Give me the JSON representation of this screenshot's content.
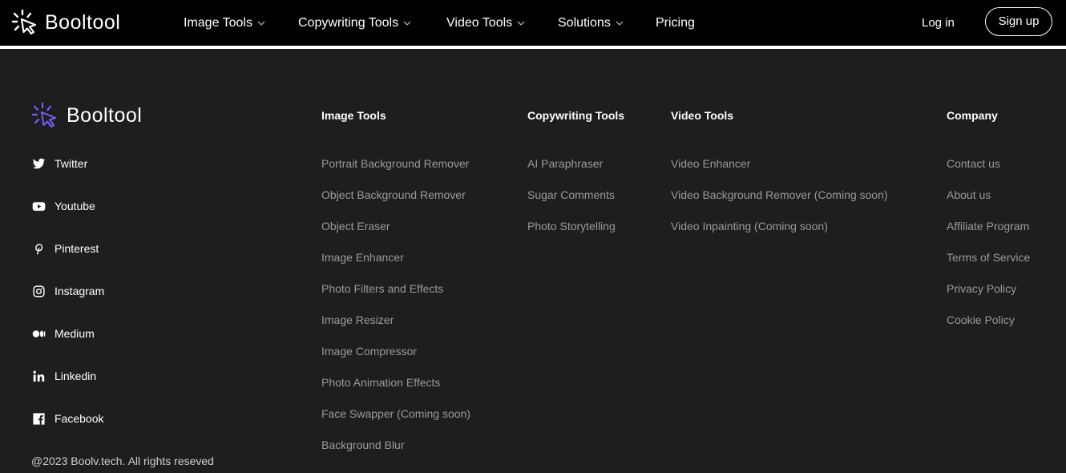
{
  "header": {
    "brand": "Booltool",
    "nav": [
      {
        "label": "Image Tools",
        "has_dropdown": true
      },
      {
        "label": "Copywriting Tools",
        "has_dropdown": true
      },
      {
        "label": "Video Tools",
        "has_dropdown": true
      },
      {
        "label": "Solutions",
        "has_dropdown": true
      },
      {
        "label": "Pricing",
        "has_dropdown": false
      }
    ],
    "login": "Log in",
    "signup": "Sign up"
  },
  "footer": {
    "brand": "Booltool",
    "brand_accent": "#7b5cff",
    "social": [
      {
        "label": "Twitter",
        "icon": "twitter-icon"
      },
      {
        "label": "Youtube",
        "icon": "youtube-icon"
      },
      {
        "label": "Pinterest",
        "icon": "pinterest-icon"
      },
      {
        "label": "Instagram",
        "icon": "instagram-icon"
      },
      {
        "label": "Medium",
        "icon": "medium-icon"
      },
      {
        "label": "Linkedin",
        "icon": "linkedin-icon"
      },
      {
        "label": "Facebook",
        "icon": "facebook-icon"
      }
    ],
    "columns": [
      {
        "title": "Image Tools",
        "links": [
          "Portrait Background Remover",
          "Object Background Remover",
          "Object Eraser",
          "Image Enhancer",
          "Photo Filters and Effects",
          "Image Resizer",
          "Image Compressor",
          "Photo Animation Effects",
          "Face Swapper (Coming soon)",
          "Background Blur"
        ]
      },
      {
        "title": "Copywriting Tools",
        "links": [
          "AI Paraphraser",
          "Sugar Comments",
          "Photo Storytelling"
        ]
      },
      {
        "title": "Video Tools",
        "links": [
          "Video Enhancer",
          "Video Background Remover (Coming soon)",
          "Video Inpainting (Coming soon)"
        ]
      },
      {
        "title": "Company",
        "links": [
          "Contact us",
          "About us",
          "Affiliate Program",
          "Terms of Service",
          "Privacy Policy",
          "Cookie Policy"
        ]
      }
    ],
    "copyright": "@2023 Boolv.tech. All rights reseved"
  }
}
